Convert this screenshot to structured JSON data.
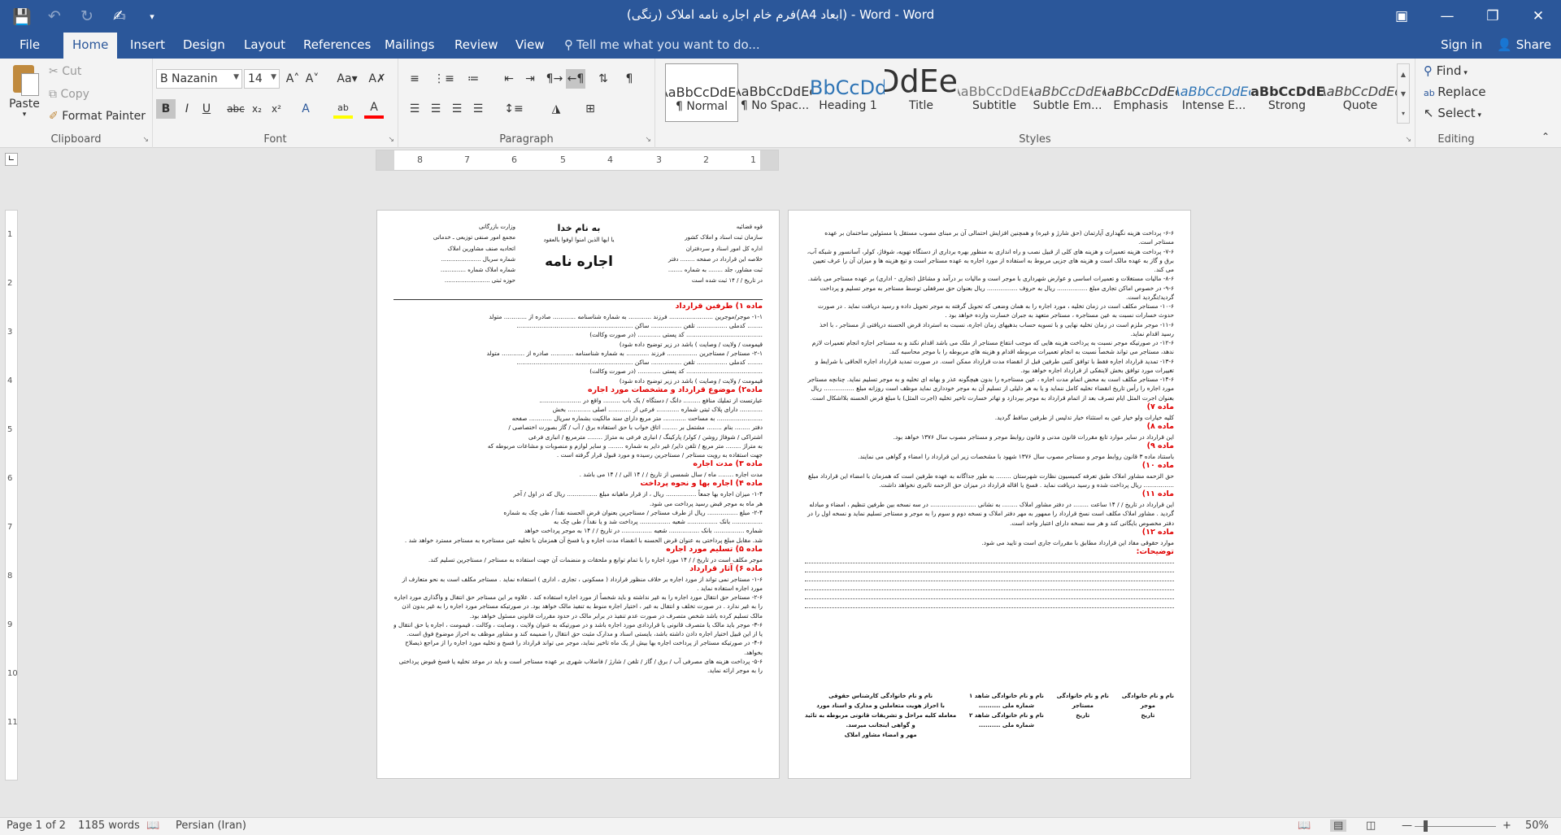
{
  "window": {
    "title": "فرم خام اجاره نامه املاک (رنگی)(A4 ابعاد) - Word - Word",
    "controls": [
      "ribbon-display-icon",
      "minimize-icon",
      "restore-icon",
      "close-icon"
    ]
  },
  "tabs": [
    "File",
    "Home",
    "Insert",
    "Design",
    "Layout",
    "References",
    "Mailings",
    "Review",
    "View"
  ],
  "active_tab": "Home",
  "tell_me": "Tell me what you want to do...",
  "account": {
    "signin": "Sign in",
    "share": "Share"
  },
  "clipboard": {
    "paste": "Paste",
    "cut": "Cut",
    "copy": "Copy",
    "format_painter": "Format Painter",
    "label": "Clipboard"
  },
  "font": {
    "name": "B Nazanin",
    "size": "14",
    "label": "Font"
  },
  "paragraph": {
    "label": "Paragraph"
  },
  "styles": {
    "label": "Styles",
    "items": [
      {
        "preview": "AaBbCcDdEe",
        "name": "¶ Normal"
      },
      {
        "preview": "AaBbCcDdEe",
        "name": "¶ No Spac..."
      },
      {
        "preview": "AaBbCcDdEe",
        "name": "Heading 1"
      },
      {
        "preview": "AaBbCcDdEe",
        "name": "Title"
      },
      {
        "preview": "AaBbCcDdEe",
        "name": "Subtitle"
      },
      {
        "preview": "AaBbCcDdEe",
        "name": "Subtle Em..."
      },
      {
        "preview": "AaBbCcDdEe",
        "name": "Emphasis"
      },
      {
        "preview": "AaBbCcDdEe",
        "name": "Intense E..."
      },
      {
        "preview": "AaBbCcDdEe",
        "name": "Strong"
      },
      {
        "preview": "AaBbCcDdEe",
        "name": "Quote"
      }
    ]
  },
  "editing": {
    "find": "Find",
    "replace": "Replace",
    "select": "Select",
    "label": "Editing"
  },
  "ruler": {
    "numbers": [
      "8",
      "7",
      "6",
      "5",
      "4",
      "3",
      "2",
      "1"
    ]
  },
  "vruler": {
    "numbers": [
      "1",
      "2",
      "3",
      "4",
      "5",
      "6",
      "7",
      "8",
      "9",
      "10",
      "11"
    ]
  },
  "doc": {
    "page1": {
      "header": {
        "right": [
          "قوه قضائیه",
          "سازمان ثبت اسناد و املاک کشور",
          "اداره کل امور اسناد و سردفتران",
          "خلاصه این قرارداد در صفحه ........ دفتر",
          "ثبت مشاور، جلد ........ به شماره ........",
          "در تاریخ  /  /  ۱۴  ثبت شده است"
        ],
        "center_title": "به نام خدا",
        "center_ayah": "یا ایها الذین امنوا اوفوا بالعقود",
        "center_main": "اجاره نامه",
        "left": [
          "وزارت بازرگانی",
          "مجمع امور صنفی توزیعی ـ خدماتی",
          "اتحادیه صنف مشاورین املاک",
          "شماره سریال ......................",
          "شماره املاک شماره ..............",
          "حوزه ثبتی ........................."
        ]
      },
      "body": [
        {
          "t": "art",
          "text": "ماده ۱) طرفین قرارداد"
        },
        {
          "t": "ln",
          "text": "۱-۱- موجر/موجرین ....................... فرزند ............ به شماره شناسنامه ............ صادره از ............ متولد"
        },
        {
          "t": "ln",
          "text": "........ کدملی ................ تلفن ................ ساکن ............................................................."
        },
        {
          "t": "ln",
          "text": "........................................ کد پستی ............ (در صورت وکالت)"
        },
        {
          "t": "ln",
          "text": "قیمومت / ولایت / وصایت ) باشد در زیر توضیح داده شود)"
        },
        {
          "t": "ln",
          "text": "۲-۱- مستاجر / مستاجرین ................ فرزند ............ به شماره شناسنامه ............ صادره از ............ متولد"
        },
        {
          "t": "ln",
          "text": "........ کدملی ................ تلفن ................ ساکن ............................................................."
        },
        {
          "t": "ln",
          "text": "........................................ کد پستی ............ (در صورت وکالت)"
        },
        {
          "t": "ln",
          "text": "قیمومت / ولایت / وصایت ) باشد در زیر توضیح داده شود)"
        },
        {
          "t": "art",
          "text": "ماده۲) موضوع قرارداد و مشخصات مورد اجاره"
        },
        {
          "t": "ln",
          "text": "عبارتست از تمليك منافع ......... دانگ / دستگاه / یک باب ......... واقع در ......................"
        },
        {
          "t": "ln",
          "text": "............ دارای پلاک ثبتی شماره ............ فرعی از ............ اصلی ............ بخش"
        },
        {
          "t": "ln",
          "text": "........................ به مساحت ............ متر مربع دارای سند مالکیت بشماره سریال ............ صفحه"
        },
        {
          "t": "ln",
          "text": "دفتر ........ بنام ........ مشتمل بر ........ اتاق خواب با حق استفاده برق / آب / گاز بصورت اختصاصی /"
        },
        {
          "t": "ln",
          "text": "اشتراکی / شوفاژ روشن / کولر/ پارکینگ / انباری فرعی به متراژ ........ مترمربع / انباری فرعی"
        },
        {
          "t": "ln",
          "text": "به متراژ ........ متر مربع / تلفن دایر/ غیر دایر به شماره ........ و سایر لوازم و منصوبات و مشاعات مربوطه که"
        },
        {
          "t": "ln",
          "text": "جهت استفاده به رویت مستاجر / مستاجرین رسیده و مورد قبول قرار گرفته است ."
        },
        {
          "t": "art",
          "text": "ماده ۳) مدت اجاره"
        },
        {
          "t": "ln",
          "text": "مدت اجاره ........ ماه / سال شمسی از تاریخ  /  / ۱۴ الی  /  / ۱۴ می باشد ."
        },
        {
          "t": "art",
          "text": "ماده ۴) اجاره بها و نحوه پرداخت"
        },
        {
          "t": "ln",
          "text": "۱-۴- میزان اجاره بها جمعاً ................ ریال ، از قرار ماهیانه مبلغ ................ ریال که در اول / آخر"
        },
        {
          "t": "ln",
          "text": "هر ماه به موجر قبض رسید پرداخت می شود."
        },
        {
          "t": "ln",
          "text": "۲-۴- مبلغ ................ ریال از طرف مستاجر / مستاجرین بعنوان قرض الحسنه نقداً / طی چک به شماره"
        },
        {
          "t": "ln",
          "text": "................ بانک ................ شعبه ................ پرداخت شد و یا نقداً / طی چک به"
        },
        {
          "t": "ln",
          "text": "شماره ................ بانک ................ شعبه ................ در تاریخ  /  / ۱۴ به موجر پرداخت خواهد"
        },
        {
          "t": "ln w",
          "text": "شد. مقابل مبلغ پرداختی به عنوان قرض الحسنه با انقضاء مدت اجاره و یا فسخ آن همزمان با تخلیه عین مستاجره به مستاجر مسترد خواهد شد ."
        },
        {
          "t": "art",
          "text": "ماده ۵) تسلیم مورد اجاره"
        },
        {
          "t": "ln w",
          "text": "موجر مکلف است در تاریخ  /  / ۱۴ مورد اجاره را با تمام توابع و ملحقات و منضمات آن جهت استفاده به مستاجر / مستاجرین تسلیم کند."
        },
        {
          "t": "art",
          "text": "ماده ۶) آثار قرارداد"
        },
        {
          "t": "ln w",
          "text": "۱-۶- مستاجر نمی تواند از مورد اجاره بر خلاف منظور قرارداد ( مسکونی ، تجاری ، اداری ) استفاده نماید . مستاجر مکلف است به نحو متعارف از مورد اجاره استفاده نماید ."
        },
        {
          "t": "ln w",
          "text": "۲-۶- مستاجر حق انتقال مورد اجاره را به غیر نداشته و باید شخصاً از مورد اجاره استفاده کند . علاوه بر این مستاجر حق انتقال و واگذاری مورد اجاره را به غیر ندارد . در صورت تخلف و انتقال به غیر ، اختیار اجاره منوط به تنفیذ مالک خواهد بود. در صورتیکه مستاجر مورد اجاره را به غیر بدون اذن مالک تسلیم کرده باشد شخص متصرف در صورت عدم تنفیذ در برابر مالک در حدود مقررات قانونی مسئول خواهد بود."
        },
        {
          "t": "ln w",
          "text": "۳-۶- موجر باید مالک یا متصرف قانونی یا قراردادی مورد اجاره باشد و در صورتیکه به عنوان ولایت ، وصایت ، وکالت ، قیمومت ، اجاره یا حق انتقال و یا از این قبیل اختیار اجاره دادن داشته باشد، بایستی اسناد و مدارک مثبت حق انتقال را ضمیمه کند و مشاور موظف به احراز موضوع فوق است."
        },
        {
          "t": "ln w",
          "text": "۴-۶- در صورتیکه مستاجر از پرداخت اجاره بها بیش از یک ماه تاخیر نماید، موجر می تواند قرارداد را فسخ و تخلیه مورد اجاره را از مراجع ذیصلاح بخواهد."
        },
        {
          "t": "ln w",
          "text": "۵-۶- پرداخت هزینه های مصرفی آب / برق / گاز / تلفن / شارژ / فاضلاب شهری بر عهده مستاجر است و باید در موعد تخلیه یا فسخ قبوض پرداختی را به موجر ارائه نماید."
        }
      ]
    },
    "page2": {
      "body": [
        {
          "t": "ln w",
          "text": "۶-۶- پرداخت هزینه نگهداری آپارتمان (حق شارژ و غیره) و همچنین افزایش احتمالی آن بر مبنای مصوب مستقل یا مسئولین ساختمان بر عهده مستاجر است."
        },
        {
          "t": "ln w",
          "text": "۷-۶- پرداخت هزینه تعمیرات و هزینه های کلی از قبیل نصب و راه اندازی به منظور بهره برداری از دستگاه تهویه، شوفاژ، کولر، آسانسور و شبکه آب، برق و گاز به عهده مالک است و هزینه های جزیی مربوط به استفاده از مورد اجاره به عهده مستاجر است و تبع هزینه ها و میزان آن را عرف تعیین می کند."
        },
        {
          "t": "ln w",
          "text": "۸-۶- مالیات مستغلات و تعمیرات اساسی و عوارض شهرداری با موجر است و مالیات بر درآمد و مشاغل (تجاری - اداری) بر عهده مستاجر می باشد."
        },
        {
          "t": "ln w",
          "text": "۹-۶- در خصوص اماکن تجاری مبلغ ................ ریال به حروف ................ ریال بعنوان حق سرقفلی توسط مستاجر به موجر تسلیم و پرداخت گردید/نگردید است."
        },
        {
          "t": "ln w",
          "text": "۱۰-۶- مستاجر مکلف است در زمان تخلیه ، مورد اجاره را به همان وضعی که تحویل گرفته به موجر تحویل داده و رسید دریافت نماید . در صورت حدوث خسارات نسبت به عین مستاجره ، مستاجر متعهد به جبران خسارت وارده خواهد بود ."
        },
        {
          "t": "ln w",
          "text": "۱۱-۶- موجر ملزم است در زمان تخلیه نهایی و با تسویه حساب بدهیهای زمان اجاره، نسبت به استرداد قرض الحسنه دریافتی از مستاجر ، با اخذ رسید اقدام نماید."
        },
        {
          "t": "ln w",
          "text": "۱۲-۶- در صورتیکه موجر نسبت به پرداخت هزینه هایی که موجب انتفاع مستاجر از ملک می باشد اقدام نکند و به مستاجر اجازه انجام تعمیرات لازم ندهد، مستاجر می تواند شخصاً نسبت به انجام تعمیرات مربوطه اقدام و هزینه های مربوطه را با موجر محاسبه کند."
        },
        {
          "t": "ln w",
          "text": "۱۳-۶- تمدید قرارداد اجاره فقط با توافق کتبی طرفین قبل از انقضاء مدت قرارداد ممکن است. در صورت تمدید قرارداد اجاره الحاقی با شرایط و تغییرات مورد توافق بخش لاینفکی از قرارداد اجاره خواهد بود."
        },
        {
          "t": "ln w",
          "text": "۱۴-۶- مستاجر مکلف است به محض اتمام مدت اجاره ، عین مستاجره را بدون هیچگونه عذر و بهانه ای تخلیه و به موجر تسلیم نماید. چنانچه مستاجر مورد اجاره را رأس تاریخ انقضاء تخلیه کامل ننماید و یا به هر دلیلی از تسلیم آن به موجر خودداری نماید موظف است روزانه مبلغ ................ ریال بعنوان اجرت المثل ایام تصرف بعد از اتمام قرارداد به موجر بپردازد و تهاتر خسارت تاخیر تخلیه (اجرت المثل) با مبلغ قرض الحسنه بلااشکال است."
        },
        {
          "t": "art",
          "text": "ماده ۷)"
        },
        {
          "t": "ln",
          "text": "کلیه خیارات ولو خیار غبن به استثناء خیار تدلیس از طرفین ساقط گردید."
        },
        {
          "t": "art",
          "text": "ماده ۸)"
        },
        {
          "t": "ln w",
          "text": "این قرارداد در سایر موارد تابع مقررات قانون مدنی و قانون روابط موجر و مستاجر مصوب سال ۱۳۷۶ خواهد بود."
        },
        {
          "t": "art",
          "text": "ماده ۹)"
        },
        {
          "t": "ln w",
          "text": "باستناد ماده ۳ قانون روابط موجر و مستاجر مصوب سال ۱۳۷۶ شهود با مشخصات زیر این قرارداد را امضاء و گواهی می نمایند."
        },
        {
          "t": "art",
          "text": "ماده ۱۰)"
        },
        {
          "t": "ln w",
          "text": "حق الزحمه مشاور املاک طبق تعرفه کمیسیون نظارت شهرستان ........ به طور جداگانه به عهده طرفین است که همزمان با امضاء این قرارداد مبلغ ................ ریال پرداخت شده و رسید دریافت نماید . فسخ یا اقاله قرارداد در میزان حق الزحمه تاثیری نخواهد داشت."
        },
        {
          "t": "art",
          "text": "ماده ۱۱)"
        },
        {
          "t": "ln w",
          "text": "این قرارداد در تاریخ  /  / ۱۴ ساعت ........ در دفتر مشاور املاک ........ به نشانی ........................ در سه نسخه بین طرفین تنظیم ، امضاء و مبادله گردید . مشاور املاک مکلف است نسخ قرارداد را ممهور به مهر دفتر املاک و نسخه دوم و سوم را به موجر و مستاجر تسلیم نماید و نسخه اول را در دفتر مخصوص بایگانی کند و هر سه نسخه دارای اعتبار واحد است."
        },
        {
          "t": "art",
          "text": "ماده ۱۲)"
        },
        {
          "t": "ln",
          "text": "موارد حقوقی مفاد این قرارداد مطابق با مقررات جاری است و تایید می شود."
        },
        {
          "t": "art",
          "text": "توضیحات:"
        }
      ],
      "dot_lines": 6,
      "signatures": [
        [
          "نام و نام خانوادگی",
          "موجر",
          "تاریخ"
        ],
        [
          "نام و نام خانوادگی",
          "مستاجر",
          "تاریخ"
        ],
        [
          "نام و نام خانوادگی شاهد ۱",
          "شماره ملی ..........",
          "نام و نام خانوادگی شاهد ۲",
          "شماره ملی .........."
        ],
        [
          "نام و نام خانوادگی کارشناس حقوقی",
          "با احراز هویت متعاملین و مدارک و اسناد مورد",
          "معامله کلیه مراحل و تشریفات قانونی مربوطه به تائید",
          "و گواهی اینجانب میرسد.",
          "مهر و امضاء مشاور املاک"
        ]
      ]
    }
  },
  "status": {
    "page": "Page 1 of 2",
    "words": "1185 words",
    "language": "Persian (Iran)",
    "zoom": "50%"
  }
}
